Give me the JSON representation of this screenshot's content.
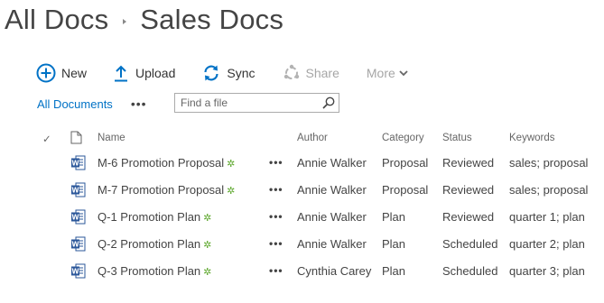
{
  "breadcrumb": {
    "root": "All Docs",
    "current": "Sales Docs"
  },
  "toolbar": {
    "new_label": "New",
    "upload_label": "Upload",
    "sync_label": "Sync",
    "share_label": "Share",
    "more_label": "More"
  },
  "views": {
    "all_documents": "All Documents",
    "more": "•••"
  },
  "search": {
    "placeholder": "Find a file",
    "icon": "search-icon"
  },
  "columns": {
    "check": "✓",
    "name": "Name",
    "author": "Author",
    "category": "Category",
    "status": "Status",
    "keywords": "Keywords"
  },
  "documents": [
    {
      "name": "M-6 Promotion Proposal",
      "author": "Annie Walker",
      "category": "Proposal",
      "status": "Reviewed",
      "keywords": "sales; proposal"
    },
    {
      "name": "M-7 Promotion Proposal",
      "author": "Annie Walker",
      "category": "Proposal",
      "status": "Reviewed",
      "keywords": "sales; proposal"
    },
    {
      "name": "Q-1 Promotion Plan",
      "author": "Annie Walker",
      "category": "Plan",
      "status": "Reviewed",
      "keywords": "quarter 1; plan"
    },
    {
      "name": "Q-2 Promotion Plan",
      "author": "Annie Walker",
      "category": "Plan",
      "status": "Scheduled",
      "keywords": "quarter 2; plan"
    },
    {
      "name": "Q-3 Promotion Plan",
      "author": "Cynthia Carey",
      "category": "Plan",
      "status": "Scheduled",
      "keywords": "quarter 3; plan"
    }
  ],
  "row_markers": {
    "new_badge": "✲",
    "ellipsis": "•••"
  },
  "colors": {
    "accent": "#0072c6",
    "word_blue": "#2b579a",
    "new_green": "#5ea82e"
  }
}
